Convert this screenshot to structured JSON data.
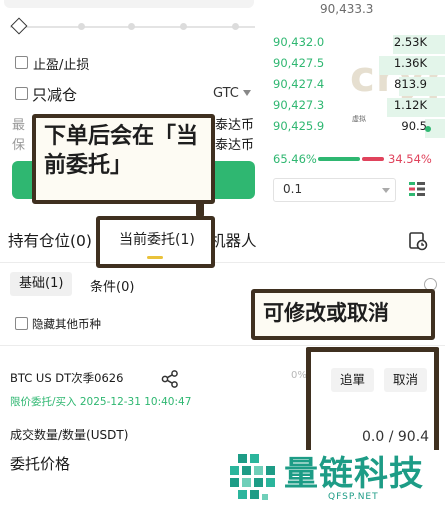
{
  "order_form": {
    "take_profit_stop_loss": "止盈/止损",
    "reduce_only": "只减仓",
    "time_in_force": "GTC",
    "max_label": "最",
    "margin_label": "保",
    "tether_1": "泰达币",
    "tether_2": "泰达币"
  },
  "order_book": {
    "top_price": "90,433.3",
    "bids": [
      {
        "price": "90,432.0",
        "qty": "2.53K"
      },
      {
        "price": "90,427.5",
        "qty": "1.36K"
      },
      {
        "price": "90,427.4",
        "qty": "813.9"
      },
      {
        "price": "90,427.3",
        "qty": "1.12K"
      },
      {
        "price": "90,425.9",
        "qty": "90.5"
      }
    ],
    "buy_ratio": "65.46%",
    "sell_ratio": "34.54%",
    "step": "0.1",
    "watermark_text": "cryp",
    "watermark_small": "虚拟"
  },
  "tabs": {
    "positions": "持有仓位(0)",
    "open_orders": "当前委托(1)",
    "bots": "机器人"
  },
  "subtabs": {
    "basic": "基础(1)",
    "conditional": "条件(0)"
  },
  "filter": {
    "hide_other": "隐藏其他币种"
  },
  "order": {
    "symbol": "BTC US DT次季0626",
    "info": "限价委托/买入 2025-12-31 10:40:47",
    "progress": "0%",
    "chase_label": "追單",
    "cancel_label": "取消",
    "filled_label": "成交数量/数量(USDT)",
    "filled_value": "0.0 / 90.4",
    "price_label": "委托价格"
  },
  "annotations": {
    "big_note": "下单后会在「当前委托」",
    "cancel_note": "可修改或取消"
  },
  "logo": {
    "name": "量链科技",
    "domain": "QFSP.NET"
  },
  "colors": {
    "buy_green": "#2fb771",
    "sell_red": "#e0435c",
    "accent_yellow": "#e9c23b",
    "annotation_border": "#3f3020",
    "logo_teal": "#1d9c86"
  }
}
